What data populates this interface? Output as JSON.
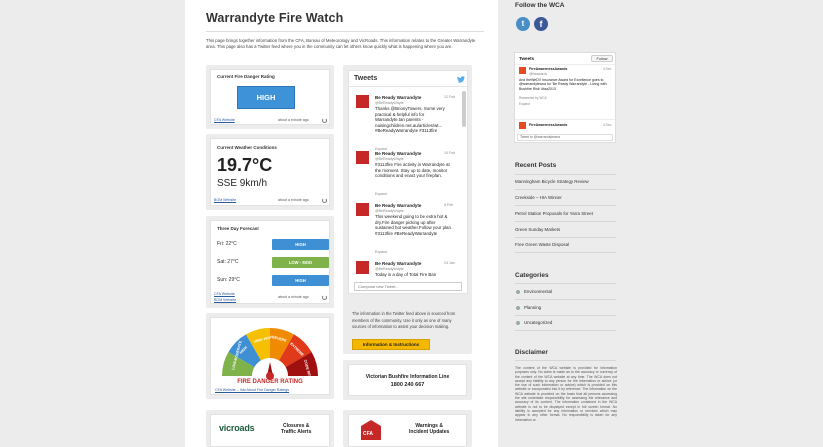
{
  "page": {
    "title": "Warrandyte Fire Watch",
    "intro": "This page brings together information from the CFA, Bureau of Meteorology and VicRoads. This information relates to the Greater Warrandyte area. This page also has a Twitter feed where you in the community can let others know quickly what is happening where you are."
  },
  "fire_danger": {
    "title": "Current Fire Danger Rating",
    "rating": "HIGH",
    "source_link": "CFA Website",
    "updated": "about a minute ago"
  },
  "weather": {
    "title": "Current Weather Conditions",
    "temperature": "19.7°C",
    "wind": "SSE 9km/h",
    "source_link": "BOM Website",
    "updated": "about a minute ago"
  },
  "forecast": {
    "title": "Three Day Forecast",
    "days": [
      {
        "label": "Fri: 22°C",
        "rating": "HIGH"
      },
      {
        "label": "Sat: 27°C",
        "rating": "LOW - MOD"
      },
      {
        "label": "Sun: 29°C",
        "rating": "HIGH"
      }
    ],
    "link1": "CFA Website",
    "link2": "BOM Website",
    "updated": "about a minute ago"
  },
  "gauge": {
    "segments": [
      "LOW-MODERATE",
      "HIGH",
      "VERY HIGH",
      "SEVERE",
      "EXTREME",
      "CODE RED"
    ],
    "caption": "FIRE DANGER RATING",
    "links": "CFA Website – Info About Fire Danger Ratings"
  },
  "tweets": {
    "title": "Tweets",
    "items": [
      {
        "name": "Be Ready Warrandyte",
        "handle": "@BeReadyWdyte",
        "date": "12 Feb",
        "text": "Thanks @BrionyTowers. Some very practical & helpful info for Warrandyte.tan parents - naisingchildren.net.au/articles/wt... #BeReadyWarrandyte #3113fire",
        "expand": "Expand"
      },
      {
        "name": "Be Ready Warrandyte",
        "handle": "@BeReadyWdyte",
        "date": "10 Feb",
        "text": "#3113fire Fire activity in Warrandyte at the moment. Stay up to date, monitor conditions and enact your fireplan.",
        "expand": "Expand"
      },
      {
        "name": "Be Ready Warrandyte",
        "handle": "@BeReadyWdyte",
        "date": "8 Feb",
        "text": "This weekend going to be extra hot & dry.Fire danger picking up after sustained hot weather.Follow your plan. #3113fire #BeReadyWarrandyte",
        "expand": "Expand"
      },
      {
        "name": "Be Ready Warrandyte",
        "handle": "@BeReadyWdyte",
        "date": "24 Jan",
        "text": "Today is a day of Total Fire Ban",
        "expand": ""
      }
    ],
    "compose_placeholder": "Compose new Tweet...",
    "note": "The information in the Twitter feed above is sourced from members of the community. Use it only as one of many sources of information to assist your decision making.",
    "button": "Information & Instructions"
  },
  "hotline": {
    "label": "Victorian Bushfire Information Line",
    "phone": "1800 240 667"
  },
  "bottom_cards": [
    {
      "logo": "vicroads",
      "label_line1": "Closures &",
      "label_line2": "Traffic Alerts"
    },
    {
      "logo": "CFA",
      "label_line1": "Warnings &",
      "label_line2": "Incident Updates"
    }
  ],
  "sidebar": {
    "follow_title": "Follow the WCA",
    "widget": {
      "title": "Tweets",
      "follow_btn": "Follow",
      "tweet1_name": "FireAwarenessAwards",
      "tweet1_handle": "@fireawards",
      "tweet1_date": "4 Dec",
      "tweet1_text": "And theWeDV Insurance Award for Excellence goes to @warrandytewca for 'Be Ready Warrandyte - Living with Bushfire Risk' #faa2013",
      "retweet": "Retweeted by WCA",
      "expand": "Expand",
      "tweet2_name": "FireAwarenessAwards",
      "tweet2_date": "4 Dec",
      "compose": "Tweet to @warrandytewca"
    },
    "recent_title": "Recent Posts",
    "recent": [
      "Manningham Bicycle Strategy Review",
      "Creekside – HIA Winner",
      "Petrol Station Proposals for Yarra Street",
      "Green Sunday Markets",
      "Free Green Waste Disposal"
    ],
    "categories_title": "Categories",
    "categories": [
      "Environmental",
      "Planning",
      "Uncategorized"
    ],
    "disclaimer_title": "Disclaimer",
    "disclaimer": "The content of the WCA website is provided for information purposes only. No claim is made as to the accuracy or currency of the content of the WCA website at any time. The WCA does not accept any liability to any person for the information or advice (or the use of such information or advice) which is provided on this website or incorporated into it by reference. The information on the WCA website is provided on the basis that all persons accessing the site undertake responsibility for assessing the relevance and accuracy of its content. The information contained in the WCA website is not to be displayed except in full screen format. No liability is accepted for any information or services which may appear in any other format. No responsibility is taken for any information or"
  },
  "colors": {
    "page_bg": "#ececec",
    "accent_blue": "#3d92d8",
    "low_mod_green": "#7fb24a",
    "cfa_red": "#c62828",
    "button_yellow": "#f5b800"
  }
}
